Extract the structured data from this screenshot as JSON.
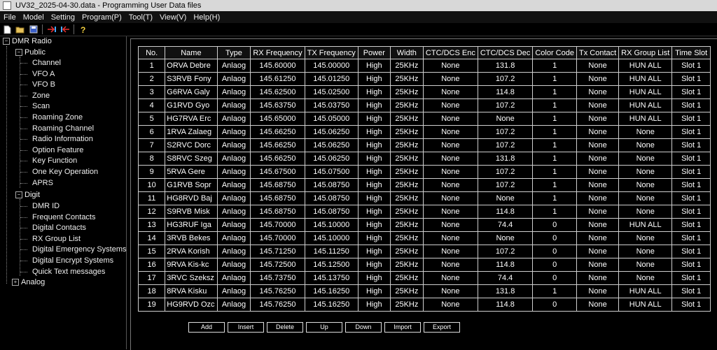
{
  "window": {
    "title": "UV32_2025-04-30.data - Programming User Data files"
  },
  "menu": [
    "File",
    "Model",
    "Setting",
    "Program(P)",
    "Tool(T)",
    "View(V)",
    "Help(H)"
  ],
  "toolbar": {
    "icons": [
      "new-file-icon",
      "open-folder-icon",
      "save-icon",
      "read-radio-icon",
      "write-radio-icon",
      "help-icon"
    ]
  },
  "tree": {
    "root": "DMR Radio",
    "public": "Public",
    "public_items": [
      "Channel",
      "VFO A",
      "VFO B",
      "Zone",
      "Scan",
      "Roaming Zone",
      "Roaming Channel",
      "Radio Information",
      "Option Feature",
      "Key Function",
      "One Key Operation",
      "APRS"
    ],
    "digit": "Digit",
    "digit_items": [
      "DMR ID",
      "Frequent Contacts",
      "Digital Contacts",
      "RX Group List",
      "Digital Emergency Systems",
      "Digital Encrypt Systems",
      "Quick Text messages"
    ],
    "analog": "Analog"
  },
  "table": {
    "columns": [
      "No.",
      "Name",
      "Type",
      "RX Frequency",
      "TX Frequency",
      "Power",
      "Width",
      "CTC/DCS Enc",
      "CTC/DCS Dec",
      "Color Code",
      "Tx Contact",
      "RX Group List",
      "Time Slot"
    ],
    "rows": [
      [
        "1",
        "ORVA Debre",
        "Anlaog",
        "145.60000",
        "145.00000",
        "High",
        "25KHz",
        "None",
        "131.8",
        "1",
        "None",
        "HUN ALL",
        "Slot 1"
      ],
      [
        "2",
        "S3RVB Fony",
        "Anlaog",
        "145.61250",
        "145.01250",
        "High",
        "25KHz",
        "None",
        "107.2",
        "1",
        "None",
        "HUN ALL",
        "Slot 1"
      ],
      [
        "3",
        "G6RVA Galy",
        "Anlaog",
        "145.62500",
        "145.02500",
        "High",
        "25KHz",
        "None",
        "114.8",
        "1",
        "None",
        "HUN ALL",
        "Slot 1"
      ],
      [
        "4",
        "G1RVD Gyo",
        "Anlaog",
        "145.63750",
        "145.03750",
        "High",
        "25KHz",
        "None",
        "107.2",
        "1",
        "None",
        "HUN ALL",
        "Slot 1"
      ],
      [
        "5",
        "HG7RVA Erc",
        "Anlaog",
        "145.65000",
        "145.05000",
        "High",
        "25KHz",
        "None",
        "None",
        "1",
        "None",
        "HUN ALL",
        "Slot 1"
      ],
      [
        "6",
        "1RVA Zalaeg",
        "Anlaog",
        "145.66250",
        "145.06250",
        "High",
        "25KHz",
        "None",
        "107.2",
        "1",
        "None",
        "None",
        "Slot 1"
      ],
      [
        "7",
        "S2RVC Dorc",
        "Anlaog",
        "145.66250",
        "145.06250",
        "High",
        "25KHz",
        "None",
        "107.2",
        "1",
        "None",
        "None",
        "Slot 1"
      ],
      [
        "8",
        "S8RVC Szeg",
        "Anlaog",
        "145.66250",
        "145.06250",
        "High",
        "25KHz",
        "None",
        "131.8",
        "1",
        "None",
        "None",
        "Slot 1"
      ],
      [
        "9",
        "5RVA Gere",
        "Anlaog",
        "145.67500",
        "145.07500",
        "High",
        "25KHz",
        "None",
        "107.2",
        "1",
        "None",
        "None",
        "Slot 1"
      ],
      [
        "10",
        "G1RVB Sopr",
        "Anlaog",
        "145.68750",
        "145.08750",
        "High",
        "25KHz",
        "None",
        "107.2",
        "1",
        "None",
        "None",
        "Slot 1"
      ],
      [
        "11",
        "HG8RVD Baj",
        "Anlaog",
        "145.68750",
        "145.08750",
        "High",
        "25KHz",
        "None",
        "None",
        "1",
        "None",
        "None",
        "Slot 1"
      ],
      [
        "12",
        "S9RVB Misk",
        "Anlaog",
        "145.68750",
        "145.08750",
        "High",
        "25KHz",
        "None",
        "114.8",
        "1",
        "None",
        "None",
        "Slot 1"
      ],
      [
        "13",
        "HG3RUF Iga",
        "Anlaog",
        "145.70000",
        "145.10000",
        "High",
        "25KHz",
        "None",
        "74.4",
        "0",
        "None",
        "HUN ALL",
        "Slot 1"
      ],
      [
        "14",
        "3RVB Bekes",
        "Anlaog",
        "145.70000",
        "145.10000",
        "High",
        "25KHz",
        "None",
        "None",
        "0",
        "None",
        "None",
        "Slot 1"
      ],
      [
        "15",
        "2RVA Korish",
        "Anlaog",
        "145.71250",
        "145.11250",
        "High",
        "25KHz",
        "None",
        "107.2",
        "0",
        "None",
        "None",
        "Slot 1"
      ],
      [
        "16",
        "9RVA Kis-kc",
        "Anlaog",
        "145.72500",
        "145.12500",
        "High",
        "25KHz",
        "None",
        "114.8",
        "0",
        "None",
        "None",
        "Slot 1"
      ],
      [
        "17",
        "3RVC Szeksz",
        "Anlaog",
        "145.73750",
        "145.13750",
        "High",
        "25KHz",
        "None",
        "74.4",
        "0",
        "None",
        "None",
        "Slot 1"
      ],
      [
        "18",
        "8RVA Kisku",
        "Anlaog",
        "145.76250",
        "145.16250",
        "High",
        "25KHz",
        "None",
        "131.8",
        "1",
        "None",
        "HUN ALL",
        "Slot 1"
      ],
      [
        "19",
        "HG9RVD Ozc",
        "Anlaog",
        "145.76250",
        "145.16250",
        "High",
        "25KHz",
        "None",
        "114.8",
        "0",
        "None",
        "HUN ALL",
        "Slot 1"
      ]
    ]
  },
  "buttons": [
    "Add",
    "Insert",
    "Delete",
    "Up",
    "Down",
    "Import",
    "Export"
  ]
}
